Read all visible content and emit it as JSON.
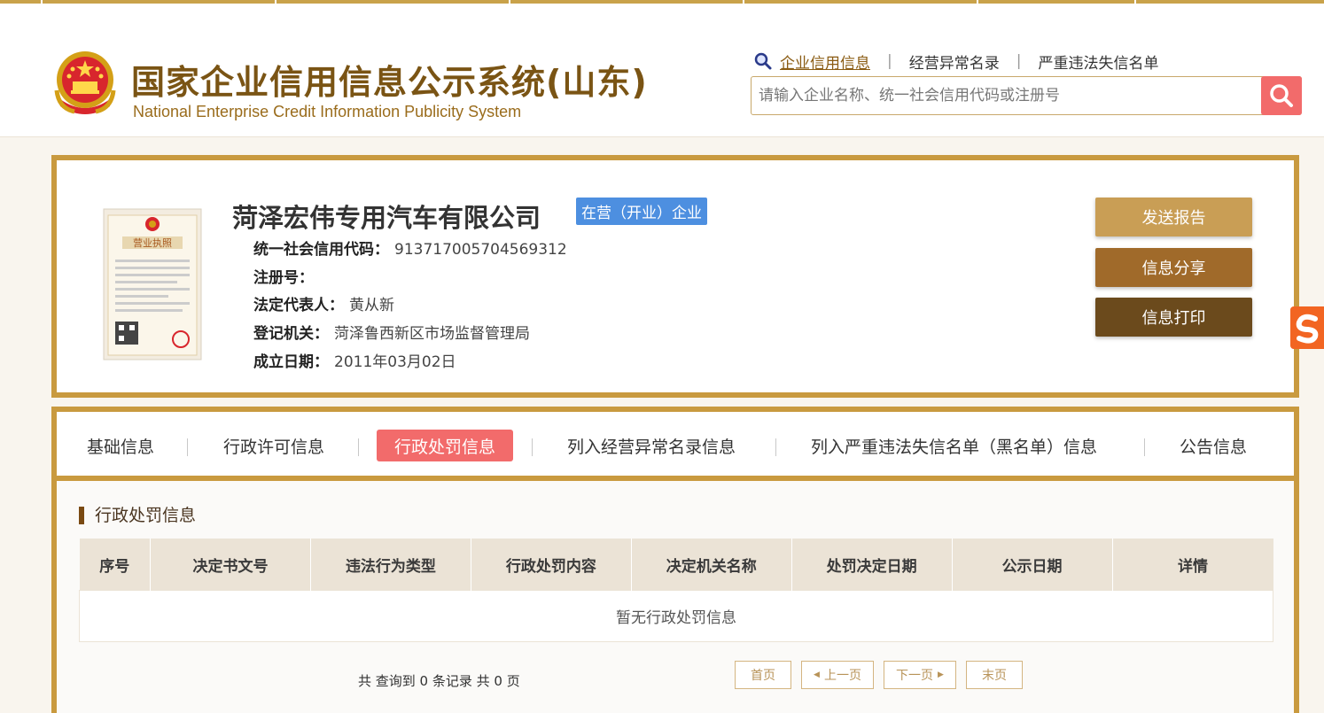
{
  "header": {
    "title_cn": "国家企业信用信息公示系统(山东)",
    "title_en": "National Enterprise Credit Information Publicity System",
    "emblem_icon": "national-emblem-icon",
    "nav": [
      {
        "label": "企业信用信息",
        "active": true
      },
      {
        "label": "经营异常名录"
      },
      {
        "label": "严重违法失信名单"
      }
    ],
    "nav_sep": "|",
    "search_placeholder": "请输入企业名称、统一社会信用代码或注册号",
    "search_icon": "search-icon"
  },
  "company": {
    "name": "菏泽宏伟专用汽车有限公司",
    "status": "在营（开业）企业",
    "license_icon": "business-license-icon",
    "fields": [
      {
        "label": "统一社会信用代码：",
        "value": "913717005704569312"
      },
      {
        "label": "注册号：",
        "value": ""
      },
      {
        "label": "法定代表人：",
        "value": "黄从新"
      },
      {
        "label": "登记机关：",
        "value": "菏泽鲁西新区市场监督管理局"
      },
      {
        "label": "成立日期：",
        "value": "2011年03月02日"
      }
    ],
    "buttons": {
      "send": "发送报告",
      "share": "信息分享",
      "print": "信息打印"
    }
  },
  "tabs": [
    {
      "label": "基础信息"
    },
    {
      "label": "行政许可信息"
    },
    {
      "label": "行政处罚信息",
      "active": true
    },
    {
      "label": "列入经营异常名录信息"
    },
    {
      "label": "列入严重违法失信名单（黑名单）信息"
    },
    {
      "label": "公告信息"
    }
  ],
  "section": {
    "title": "行政处罚信息",
    "columns": [
      "序号",
      "决定书文号",
      "违法行为类型",
      "行政处罚内容",
      "决定机关名称",
      "处罚决定日期",
      "公示日期",
      "详情"
    ],
    "empty_text": "暂无行政处罚信息",
    "record_count": "共 查询到 0 条记录 共 0 页"
  },
  "pagination": {
    "first": "首页",
    "prev": "上一页",
    "next": "下一页",
    "last": "末页"
  },
  "colors": {
    "accent_gold": "#c99a3f",
    "active_red": "#f26b6b",
    "badge_blue": "#4d8fe0"
  }
}
